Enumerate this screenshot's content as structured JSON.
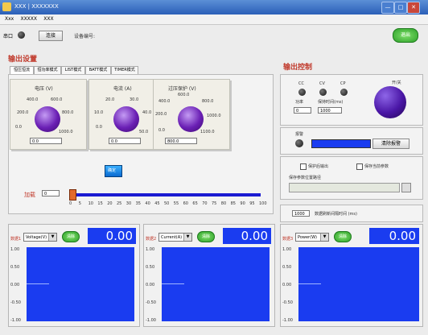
{
  "window": {
    "title": "XXX | XXXXXXX"
  },
  "menu": [
    "Xxx",
    "XXXXX",
    "XXX"
  ],
  "toolbar": {
    "port_label": "串口",
    "btn_label": "连接",
    "status_label": "设备编号:",
    "right_btn": "退出"
  },
  "output_settings": {
    "title": "输出设置",
    "tabs": [
      "恒压恒流",
      "恒功率模式",
      "LIST模式",
      "BATT模式",
      "TIMER模式"
    ]
  },
  "knobs": [
    {
      "title": "电压 (V)",
      "scale": [
        "0.0",
        "200.0",
        "400.0",
        "600.0",
        "800.0",
        "1000.0"
      ],
      "value": "0.0"
    },
    {
      "title": "电流 (A)",
      "scale": [
        "0.0",
        "10.0",
        "20.0",
        "30.0",
        "40.0",
        "50.0"
      ],
      "value": "0.0"
    },
    {
      "title": "过压保护 (V)",
      "scale": [
        "0.0",
        "200.0",
        "400.0",
        "600.0",
        "800.0",
        "1000.0",
        "1100.0"
      ],
      "value": "800.0"
    }
  ],
  "apply_button": "确定",
  "slider": {
    "label": "加载",
    "value": "0",
    "ticks": [
      "0",
      "5",
      "10",
      "15",
      "20",
      "25",
      "30",
      "35",
      "40",
      "45",
      "50",
      "55",
      "60",
      "65",
      "70",
      "75",
      "80",
      "85",
      "90",
      "95",
      "100"
    ]
  },
  "output_control": {
    "title": "输出控制",
    "leds": [
      "CC",
      "CV",
      "CP"
    ],
    "power_label": "开/关",
    "mode_label": "功率",
    "time_label": "保持时间(ms)",
    "mode_value": "0",
    "time_value": "1000"
  },
  "alarm": {
    "label": "报警",
    "button": "清除报警"
  },
  "options": {
    "chk1": "保护后输出",
    "chk2": "保存当前参数",
    "path_label": "保存参数位置路径",
    "interval_value": "1000",
    "interval_label": "数据刷新间隔时间 (ms)"
  },
  "graphs": [
    {
      "label": "数据1",
      "channel": "Voltage(V)",
      "btn": "清除",
      "value": "0.00",
      "yticks": [
        "1.00",
        "0.50",
        "0.00",
        "-0.50",
        "-1.00"
      ]
    },
    {
      "label": "数据2",
      "channel": "Current(A)",
      "btn": "清除",
      "value": "0.00",
      "yticks": [
        "1.00",
        "0.50",
        "0.00",
        "-0.50",
        "-1.00"
      ]
    },
    {
      "label": "数据3",
      "channel": "Power(W)",
      "btn": "清除",
      "value": "0.00",
      "yticks": [
        "1.00",
        "0.50",
        "0.00",
        "-0.50",
        "-1.00"
      ]
    }
  ],
  "colors": {
    "accent": "#1a3cf0",
    "title_red": "#c0392b",
    "knob": "#6a1fb4"
  }
}
